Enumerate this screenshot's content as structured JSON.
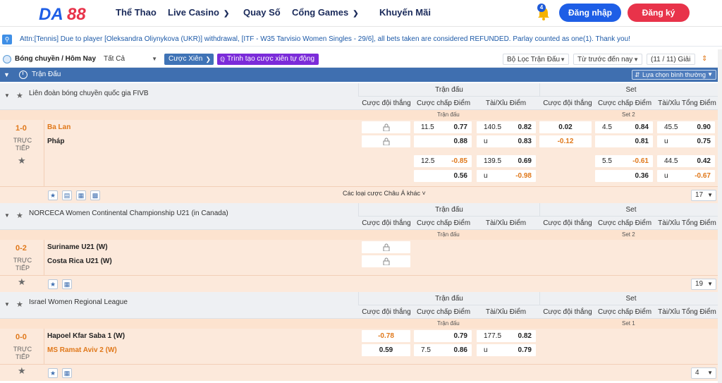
{
  "header": {
    "logo": "DA88",
    "nav": [
      {
        "label": "Thể Thao",
        "dropdown": false
      },
      {
        "label": "Live Casino",
        "dropdown": true
      },
      {
        "label": "Quay Số",
        "dropdown": false
      },
      {
        "label": "Cổng Games",
        "dropdown": true
      },
      {
        "label": "Khuyến Mãi",
        "dropdown": false
      }
    ],
    "bell_count": "4",
    "login_label": "Đăng nhập",
    "register_label": "Đăng ký"
  },
  "announcement": "Attn:[Tennis] Due to player [Oleksandra Oliynykova (UKR)] withdrawal, [ITF - W35 Tarvisio Women Singles - 29/6], all bets taken are considered REFUNDED. Parlay counted as one(1). Thank you!",
  "filter": {
    "sport_title": "Bóng chuyền / Hôm Nay",
    "all_select": "Tất Cả",
    "combo_label": "Cược Xiên",
    "auto_label": "Trình tạo cược xiên tự động",
    "match_filter": "Bộ Lọc Trận Đấu",
    "sort": "Từ trước đến nay",
    "leagues_count": "(11 / 11) Giải"
  },
  "section": {
    "label": "Trận Đấu",
    "option_label": "Lựa chọn bình thường"
  },
  "columns": {
    "group_match": "Trận đấu",
    "group_set": "Set",
    "winner": "Cược đội thắng",
    "handicap": "Cược chấp Điểm",
    "ou": "Tài/Xỉu Điểm",
    "ou_total": "Tài/Xỉu Tổng Điểm"
  },
  "leagues": [
    {
      "name": "Liên đoàn bóng chuyền quốc gia FIVB",
      "sub_left": "Trận đấu",
      "sub_right": "Set 2",
      "score": "1-0",
      "live": "TRỰC TIẾP",
      "home": "Ba Lan",
      "away": "Pháp",
      "more": "Các loại cược Châu Á khác",
      "count": "17",
      "rows": [
        {
          "hc_l": "11.5",
          "hc_r": "0.77",
          "ou_l": "140.5",
          "ou_r": "0.82",
          "s_win": "0.02",
          "s_hc_l": "4.5",
          "s_hc_r": "0.84",
          "s_ou_l": "45.5",
          "s_ou_r": "0.90"
        },
        {
          "hc_l": "",
          "hc_r": "0.88",
          "ou_l": "u",
          "ou_r": "0.83",
          "s_win": "-0.12",
          "s_hc_l": "",
          "s_hc_r": "0.81",
          "s_ou_l": "u",
          "s_ou_r": "0.75"
        },
        {
          "hc_l": "12.5",
          "hc_r": "-0.85",
          "ou_l": "139.5",
          "ou_r": "0.69",
          "s_win": "",
          "s_hc_l": "5.5",
          "s_hc_r": "-0.61",
          "s_ou_l": "44.5",
          "s_ou_r": "0.42"
        },
        {
          "hc_l": "",
          "hc_r": "0.56",
          "ou_l": "u",
          "ou_r": "-0.98",
          "s_win": "",
          "s_hc_l": "",
          "s_hc_r": "0.36",
          "s_ou_l": "u",
          "s_ou_r": "-0.67"
        }
      ]
    },
    {
      "name": "NORCECA Women Continental Championship U21 (in Canada)",
      "sub_left": "Trận đấu",
      "sub_right": "Set 2",
      "score": "0-2",
      "live": "TRỰC TIẾP",
      "home": "Suriname U21 (W)",
      "away": "Costa Rica U21 (W)",
      "count": "19"
    },
    {
      "name": "Israel Women Regional League",
      "sub_left": "Trận đấu",
      "sub_right": "Set 1",
      "score": "0-0",
      "live": "TRỰC TIẾP",
      "home": "Hapoel Kfar Saba 1 (W)",
      "away": "MS Ramat Aviv 2 (W)",
      "count": "4",
      "rows": [
        {
          "win": "-0.78",
          "hc_l": "",
          "hc_r": "0.79",
          "ou_l": "177.5",
          "ou_r": "0.82"
        },
        {
          "win": "0.59",
          "hc_l": "7.5",
          "hc_r": "0.86",
          "ou_l": "u",
          "ou_r": "0.79"
        }
      ]
    }
  ],
  "colors": {
    "brand_blue": "#1e5ee6",
    "register_red": "#e8334a",
    "section_blue": "#3f6fb0",
    "accent_orange": "#e0781a"
  }
}
